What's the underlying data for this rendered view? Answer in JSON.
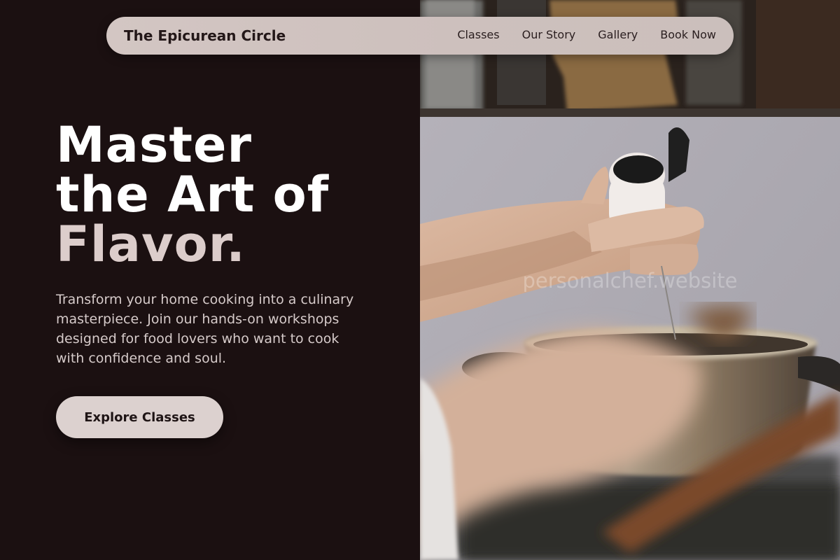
{
  "nav": {
    "brand": "The Epicurean Circle",
    "links": [
      "Classes",
      "Our Story",
      "Gallery",
      "Book Now"
    ]
  },
  "hero": {
    "headline_line1": "Master",
    "headline_line2": "the Art of",
    "headline_accent": "Flavor.",
    "lead": "Transform your home cooking into a culinary masterpiece. Join our hands-on workshops designed for food lovers who want to cook with confidence and soul.",
    "cta_label": "Explore Classes"
  },
  "photo": {
    "watermark": "personalchef.website"
  },
  "colors": {
    "background": "#1b1011",
    "accent_text": "#dccdcb",
    "nav_bg": "#d3c6c3",
    "button_bg": "#dcd1cf"
  }
}
